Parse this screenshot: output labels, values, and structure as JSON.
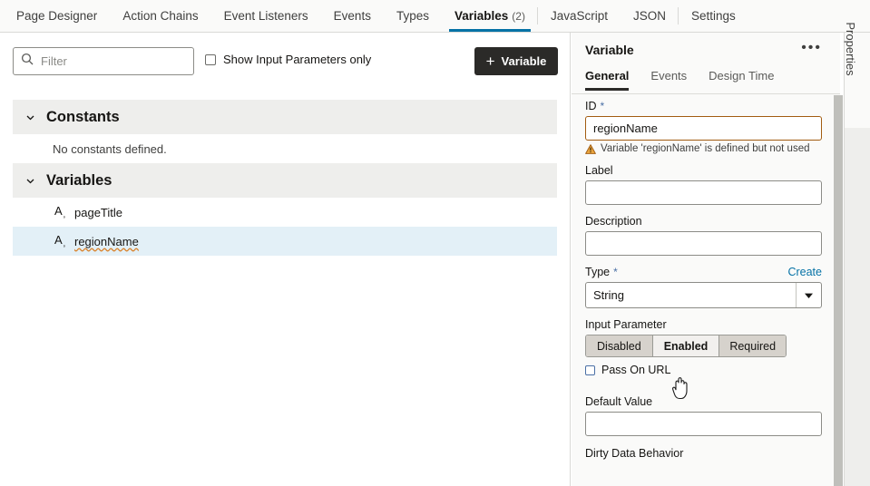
{
  "tabs": [
    {
      "label": "Page Designer",
      "active": false
    },
    {
      "label": "Action Chains",
      "active": false
    },
    {
      "label": "Event Listeners",
      "active": false
    },
    {
      "label": "Events",
      "active": false
    },
    {
      "label": "Types",
      "active": false
    },
    {
      "label": "Variables",
      "count": "(2)",
      "active": true
    },
    {
      "label": "JavaScript",
      "active": false
    },
    {
      "label": "JSON",
      "active": false
    },
    {
      "label": "Settings",
      "active": false
    }
  ],
  "toolbar": {
    "filter_placeholder": "Filter",
    "filter_value": "",
    "search_icon": "search-icon",
    "show_input_params_label": "Show Input Parameters only",
    "show_input_params_checked": false,
    "add_variable_label": "Variable",
    "add_variable_plus": "+"
  },
  "sections": [
    {
      "title": "Constants",
      "expanded": true,
      "empty_message": "No constants defined.",
      "items": []
    },
    {
      "title": "Variables",
      "expanded": true,
      "empty_message": "",
      "items": [
        {
          "name": "pageTitle",
          "icon": "string-variable-icon",
          "selected": false,
          "squiggle": false
        },
        {
          "name": "regionName",
          "icon": "string-variable-icon",
          "selected": true,
          "squiggle": true
        }
      ]
    }
  ],
  "properties_panel": {
    "title": "Variable",
    "overflow_menu": "•••",
    "subtabs": [
      {
        "label": "General",
        "active": true
      },
      {
        "label": "Events",
        "active": false
      },
      {
        "label": "Design Time",
        "active": false
      }
    ],
    "fields": {
      "id_label": "ID",
      "id_required": "*",
      "id_value": "regionName",
      "id_warning": "Variable 'regionName' is defined but not used",
      "id_warning_icon": "warning-triangle-icon",
      "label_label": "Label",
      "label_value": "",
      "description_label": "Description",
      "description_value": "",
      "type_label": "Type",
      "type_required": "*",
      "type_create_link": "Create",
      "type_value": "String",
      "input_parameter_label": "Input Parameter",
      "input_parameter_options": [
        "Disabled",
        "Enabled",
        "Required"
      ],
      "input_parameter_selected": "Enabled",
      "pass_on_url_label": "Pass On URL",
      "pass_on_url_checked": false,
      "default_value_label": "Default Value",
      "default_value": "",
      "dirty_data_behavior_label": "Dirty Data Behavior"
    }
  },
  "right_strip": {
    "properties_label": "Properties"
  },
  "colors": {
    "accent_tab_underline": "#0572a6",
    "warning_border": "#a25c11",
    "selected_row": "#e3f0f7",
    "section_header_bg": "#eeeeec",
    "dark_button": "#2b2a28",
    "link": "#0572a6"
  }
}
